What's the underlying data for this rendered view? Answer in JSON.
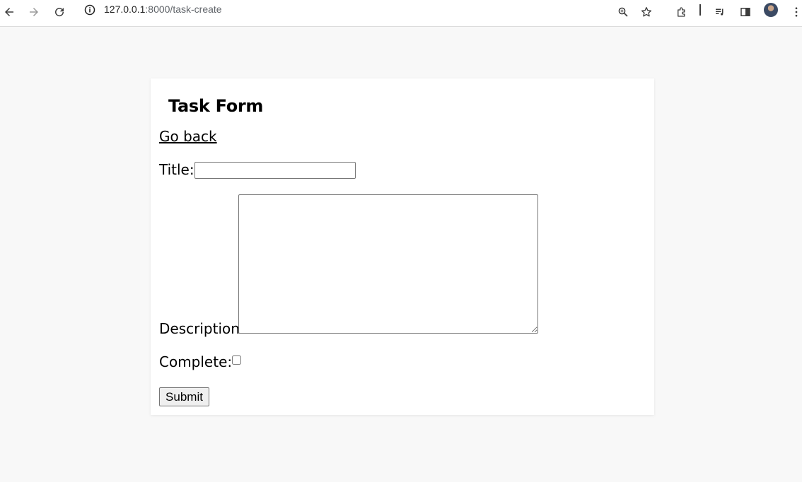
{
  "browser": {
    "url_host": "127.0.0.1",
    "url_path": ":8000/task-create"
  },
  "form": {
    "heading": "Task Form",
    "back_link": "Go back",
    "title_label": "Title:",
    "title_value": "",
    "description_label": "Description:",
    "description_value": "",
    "complete_label": "Complete:",
    "complete_checked": false,
    "submit_label": "Submit"
  }
}
